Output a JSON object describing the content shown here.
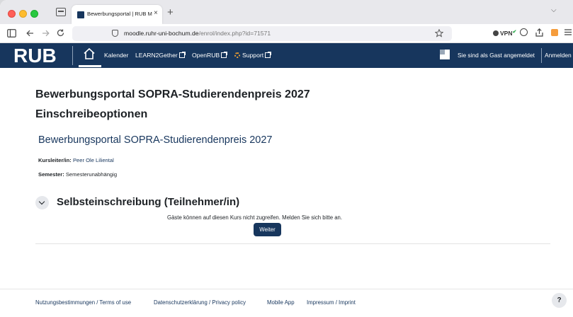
{
  "browser": {
    "tab_title": "Bewerbungsportal | RUB Moodle",
    "tab_close": "×",
    "new_tab": "+",
    "tab_list": "⌵",
    "url_host": "moodle.ruhr-uni-bochum.de",
    "url_path": "/enrol/index.php?id=71571",
    "vpn_label": "VPN",
    "icons": [
      "sidebar-icon",
      "back-icon",
      "forward-icon",
      "reload-icon",
      "shield-icon",
      "star-icon",
      "account-icon",
      "share-icon",
      "extension-icon",
      "menu-icon"
    ]
  },
  "header": {
    "logo": "RUB",
    "menu": {
      "kalender": "Kalender",
      "learn2gether": "LEARN2Gether",
      "openrub": "OpenRUB",
      "support": "Support"
    },
    "guest_text": "Sie sind als Gast angemeldet",
    "login": "Anmelden",
    "brand_color": "#17365d"
  },
  "main": {
    "title": "Bewerbungsportal SOPRA-Studierendenpreis 2027",
    "subtitle": "Einschreibeoptionen",
    "course_name": "Bewerbungsportal SOPRA-Studierendenpreis 2027",
    "teacher_label": "Kursleiter/in:",
    "teacher_name": "Peer Ole Liliental",
    "semester_label": "Semester:",
    "semester_value": "Semesterunabhängig",
    "section_title": "Selbsteinschreibung (Teilnehmer/in)",
    "guest_message": "Gäste können auf diesen Kurs nicht zugreifen. Melden Sie sich bitte an.",
    "continue_button": "Weiter"
  },
  "footer": {
    "terms": "Nutzungsbestimmungen / Terms of use",
    "privacy": "Datenschutzerklärung / Privacy policy",
    "mobile": "Mobile App",
    "imprint": "Impressum / Imprint",
    "help": "?"
  }
}
